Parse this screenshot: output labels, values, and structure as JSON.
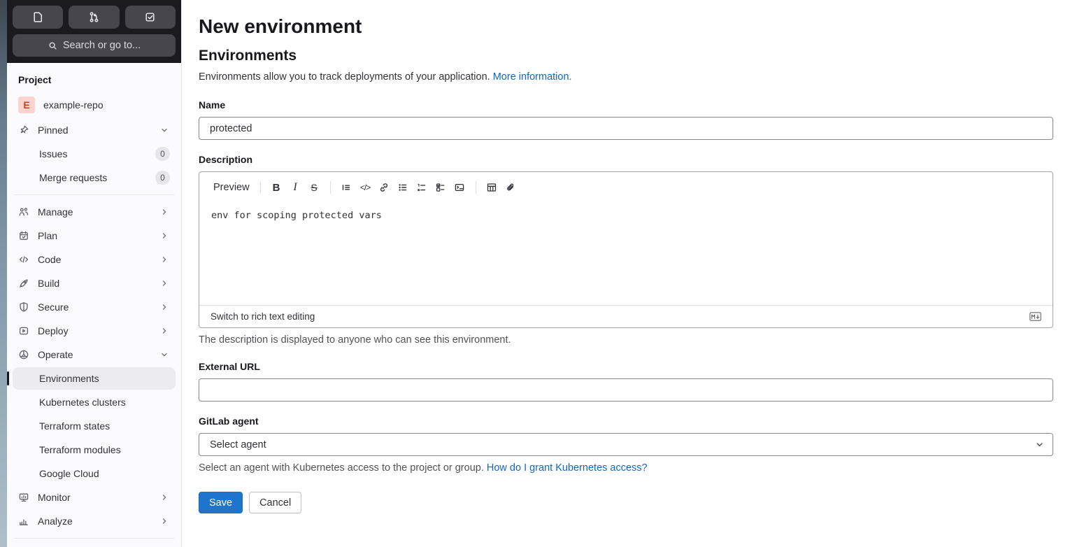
{
  "topbar": {
    "search_placeholder": "Search or go to...",
    "buttons": [
      {
        "name": "issues"
      },
      {
        "name": "merge-requests"
      },
      {
        "name": "todos"
      }
    ]
  },
  "sidebar": {
    "section_label": "Project",
    "project": {
      "avatar_letter": "E",
      "name": "example-repo"
    },
    "items": [
      {
        "label": "Pinned",
        "icon": "pin",
        "chevron": "down"
      },
      {
        "label": "Issues",
        "badge": "0"
      },
      {
        "label": "Merge requests",
        "badge": "0"
      },
      {
        "label": "Manage",
        "icon": "users",
        "chevron": "right"
      },
      {
        "label": "Plan",
        "icon": "calendar",
        "chevron": "right"
      },
      {
        "label": "Code",
        "icon": "code",
        "chevron": "right"
      },
      {
        "label": "Build",
        "icon": "rocket",
        "chevron": "right"
      },
      {
        "label": "Secure",
        "icon": "shield",
        "chevron": "right"
      },
      {
        "label": "Deploy",
        "icon": "deploy",
        "chevron": "right"
      },
      {
        "label": "Operate",
        "icon": "operate",
        "chevron": "down"
      },
      {
        "label": "Environments",
        "active": true
      },
      {
        "label": "Kubernetes clusters"
      },
      {
        "label": "Terraform states"
      },
      {
        "label": "Terraform modules"
      },
      {
        "label": "Google Cloud"
      },
      {
        "label": "Monitor",
        "icon": "monitor",
        "chevron": "right"
      },
      {
        "label": "Analyze",
        "icon": "analyze",
        "chevron": "right"
      }
    ]
  },
  "main": {
    "title": "New environment",
    "section_title": "Environments",
    "intro_text": "Environments allow you to track deployments of your application.",
    "intro_link": "More information.",
    "name_field": {
      "label": "Name",
      "value": "protected"
    },
    "description_field": {
      "label": "Description",
      "toolbar": {
        "preview": "Preview",
        "bold": "B",
        "italic": "I",
        "strike": "S",
        "code": "</>"
      },
      "value": "env for scoping protected vars",
      "footer_link": "Switch to rich text editing",
      "help_text": "The description is displayed to anyone who can see this environment."
    },
    "external_url_field": {
      "label": "External URL",
      "value": ""
    },
    "agent_field": {
      "label": "GitLab agent",
      "value": "Select agent",
      "help_text": "Select an agent with Kubernetes access to the project or group.",
      "help_link": "How do I grant Kubernetes access?"
    },
    "actions": {
      "save": "Save",
      "cancel": "Cancel"
    }
  },
  "colors": {
    "topbar_bg": "#1b1a1f",
    "topbar_button_bg": "#47464c",
    "sidebar_bg": "#fbfafd",
    "sidebar_active_bg": "#ececef",
    "link_blue": "#1068bf",
    "primary_button_bg": "#1f75cb",
    "avatar_bg": "#fdd4cd",
    "input_border": "#89888d"
  }
}
